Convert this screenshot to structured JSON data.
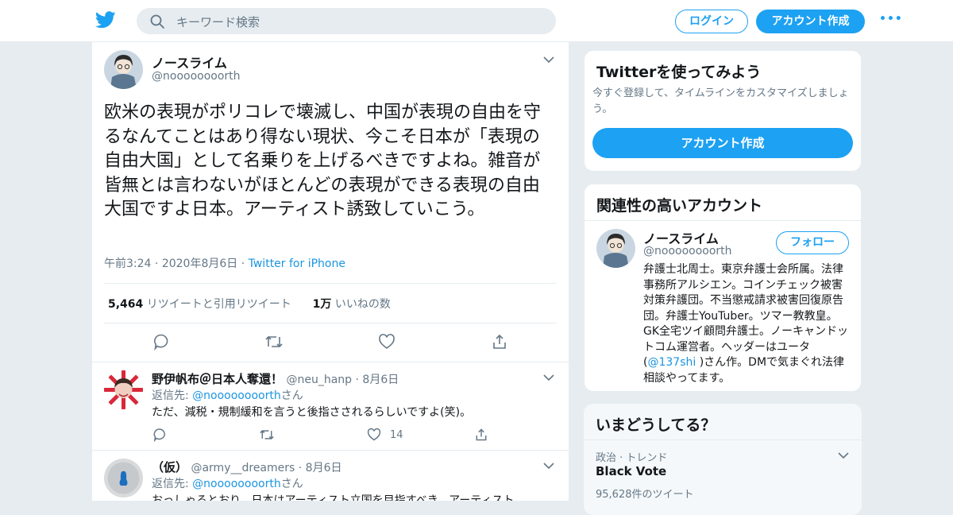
{
  "header": {
    "search_placeholder": "キーワード検索",
    "login_label": "ログイン",
    "signup_label": "アカウント作成",
    "more_label": "•••"
  },
  "tweet": {
    "author_name": "ノースライム",
    "author_handle": "@noooooooorth",
    "text": "欧米の表現がポリコレで壊滅し、中国が表現の自由を守るなんてことはあり得ない現状、今こそ日本が「表現の自由大国」として名乗りを上げるべきですよね。雑音が皆無とは言わないがほとんどの表現ができる表現の自由大国ですよ日本。アーティスト誘致していこう。",
    "time": "午前3:24",
    "date": "2020年8月6日",
    "source": "Twitter for iPhone",
    "retweet_count": "5,464",
    "retweet_label": "リツイートと引用リツイート",
    "like_count": "1万",
    "like_label": "いいねの数"
  },
  "replies": [
    {
      "name": "野伊帆布＠日本人奪還！",
      "handle": "@neu_hanp",
      "date": "8月6日",
      "reply_to_prefix": "返信先: ",
      "reply_to_handle": "@noooooooorth",
      "reply_to_suffix": "さん",
      "text": "ただ、減税・規制緩和を言うと後指さされるらしいですよ(笑)。",
      "like_count": "14"
    },
    {
      "name": "（仮）",
      "handle": "@army__dreamers",
      "date": "8月6日",
      "reply_to_prefix": "返信先: ",
      "reply_to_handle": "@noooooooorth",
      "reply_to_suffix": "さん",
      "text": "おっしゃるとおり、日本はアーティスト立国を目指すべき。アーティスト"
    }
  ],
  "sidebar": {
    "signup_card": {
      "title": "Twitterを使ってみよう",
      "subtitle": "今すぐ登録して、タイムラインをカスタマイズしましょう。",
      "button": "アカウント作成"
    },
    "related_card": {
      "title": "関連性の高いアカウント",
      "name": "ノースライム",
      "handle": "@noooooooorth",
      "follow_label": "フォロー",
      "bio_before": "弁護士北周士。東京弁護士会所属。法律事務所アルシエン。コインチェック被害対策弁護団。不当懲戒請求被害回復原告団。弁護士YouTuber。ツマー教教皇。GK全宅ツイ顧問弁護士。ノーキャンドットコム運営者。ヘッダーはユータ(",
      "bio_link": "@137shi",
      "bio_after": " )さん作。DMで気まぐれ法律相談やってます。"
    },
    "trends_card": {
      "title": "いまどうしてる？",
      "category": "政治 · トレンド",
      "topic": "Black Vote",
      "count": "95,628件のツイート"
    }
  },
  "colors": {
    "accent": "#1da1f2",
    "background": "#e6ecf0",
    "secondary_text": "#657786"
  },
  "icons": [
    "twitter-bird-icon",
    "search-icon",
    "chevron-down-icon",
    "reply-icon",
    "retweet-icon",
    "like-icon",
    "share-icon"
  ]
}
